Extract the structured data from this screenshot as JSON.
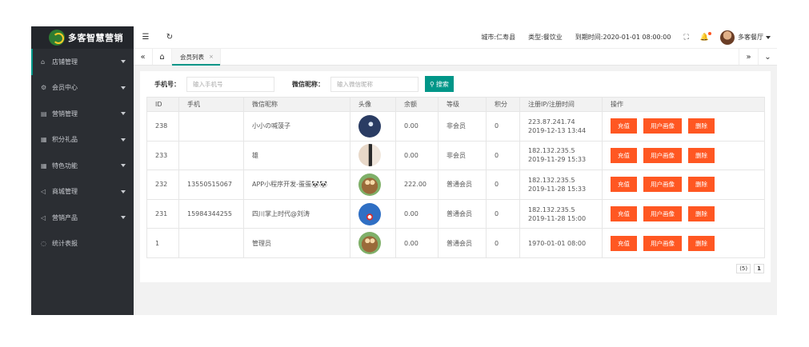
{
  "logo": {
    "text": "多客智慧营销"
  },
  "sidebar": {
    "items": [
      {
        "icon": "home-icon",
        "glyph": "⌂",
        "label": "店铺管理",
        "caret": true,
        "active": true
      },
      {
        "icon": "gear-icon",
        "glyph": "⚙",
        "label": "会员中心",
        "caret": true
      },
      {
        "icon": "book-icon",
        "glyph": "▤",
        "label": "营销管理",
        "caret": true
      },
      {
        "icon": "grid-icon",
        "glyph": "▦",
        "label": "积分礼品",
        "caret": true
      },
      {
        "icon": "apps-icon",
        "glyph": "▦",
        "label": "特色功能",
        "caret": true
      },
      {
        "icon": "send-icon",
        "glyph": "◁",
        "label": "商城管理",
        "caret": true
      },
      {
        "icon": "send-icon",
        "glyph": "◁",
        "label": "营销产品",
        "caret": true
      },
      {
        "icon": "chart-icon",
        "glyph": "◌",
        "label": "统计表报",
        "caret": false
      }
    ]
  },
  "header": {
    "city": "城市:仁寿县",
    "type": "类型:餐饮业",
    "expire": "到期时间:2020-01-01 08:00:00",
    "user": "多客餐厅"
  },
  "tabs": {
    "active_label": "会员列表",
    "close_glyph": "×"
  },
  "filters": {
    "phone_label": "手机号：",
    "phone_placeholder": "输入手机号",
    "nick_label": "微信昵称：",
    "nick_placeholder": "输入微信昵称",
    "search_label": "搜索"
  },
  "table": {
    "columns": [
      "ID",
      "手机",
      "微信昵称",
      "头像",
      "余额",
      "等级",
      "积分",
      "注册IP/注册时间",
      "操作"
    ],
    "rows": [
      {
        "id": "238",
        "phone": "",
        "nick": "小小の喊菠子",
        "avatar": 0,
        "balance": "0.00",
        "level": "非会员",
        "points": "0",
        "ip": "223.87.241.74",
        "time": "2019-12-13 13:44"
      },
      {
        "id": "233",
        "phone": "",
        "nick": "雄",
        "avatar": 1,
        "balance": "0.00",
        "level": "非会员",
        "points": "0",
        "ip": "182.132.235.5",
        "time": "2019-11-29 15:33"
      },
      {
        "id": "232",
        "phone": "13550515067",
        "nick": "APP小程序开发-蛋蛋🐼🐼",
        "avatar": 2,
        "balance": "222.00",
        "level": "普通会员",
        "points": "0",
        "ip": "182.132.235.5",
        "time": "2019-11-28 15:33"
      },
      {
        "id": "231",
        "phone": "15984344255",
        "nick": "四川掌上时代@刘涛",
        "avatar": 3,
        "balance": "0.00",
        "level": "普通会员",
        "points": "0",
        "ip": "182.132.235.5",
        "time": "2019-11-28 15:00"
      },
      {
        "id": "1",
        "phone": "",
        "nick": "管理员",
        "avatar": 4,
        "balance": "0.00",
        "level": "普通会员",
        "points": "0",
        "ip": "",
        "time": "1970-01-01 08:00"
      }
    ],
    "actions": [
      "充值",
      "用户画像",
      "删除"
    ]
  },
  "pager": {
    "count": "(5)",
    "page": "1"
  },
  "colors": {
    "sidebar_bg": "#2b2e33",
    "accent": "#009688",
    "danger": "#ff5722"
  }
}
